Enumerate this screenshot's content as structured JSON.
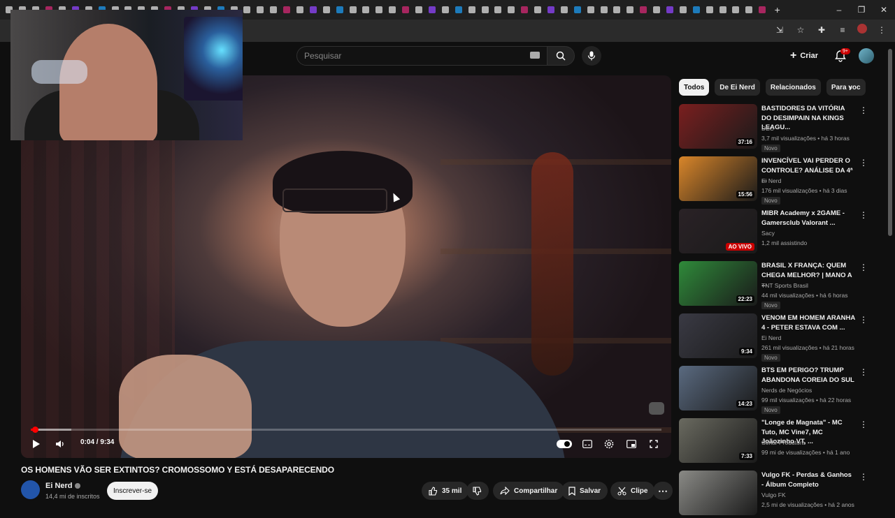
{
  "browser": {
    "tabs": [
      {
        "icon": "tiktok-icon",
        "color": "#e0e0e0"
      },
      {
        "icon": "x-icon",
        "color": "#e0e0e0"
      },
      {
        "icon": "tiktok-icon",
        "color": "#e0e0e0"
      },
      {
        "icon": "instagram-icon",
        "color": "#d62976"
      },
      {
        "icon": "tiktok-icon",
        "color": "#e0e0e0"
      },
      {
        "icon": "twitch-icon",
        "color": "#9146ff"
      },
      {
        "icon": "tiktok-icon",
        "color": "#e0e0e0"
      },
      {
        "icon": "bluesky-icon",
        "color": "#1d9bf0"
      },
      {
        "icon": "x-icon",
        "color": "#e0e0e0"
      }
    ],
    "new_tab": "+",
    "window_controls": [
      "–",
      "❐",
      "✕"
    ]
  },
  "header": {
    "search_placeholder": "Pesquisar",
    "create_label": "Criar",
    "notification_count": "9+"
  },
  "player": {
    "time": "0:04 / 9:34",
    "progress_fraction": 0.007,
    "buffer_fraction": 0.064
  },
  "video": {
    "title": "OS HOMENS VÃO SER EXTINTOS? CROMOSSOMO Y ESTÁ DESAPARECENDO",
    "channel": "Ei Nerd",
    "subscribers": "14,4 mi de inscritos",
    "subscribe_label": "Inscrever-se",
    "likes": "35 mil",
    "share_label": "Compartilhar",
    "save_label": "Salvar",
    "clip_label": "Clipe"
  },
  "chips": [
    "Todos",
    "De Ei Nerd",
    "Relacionados",
    "Para voc"
  ],
  "recommendations": [
    {
      "title": "BASTIDORES DA VITÓRIA DO DESIMPAIN NA KINGS LEAGU...",
      "channel": "DEC",
      "meta": "3,7 mil visualizações • há 3 horas",
      "badge": "Novo",
      "duration": "37:16",
      "thumb": "#7a1f1f"
    },
    {
      "title": "INVENCÍVEL VAI PERDER O CONTROLE? ANÁLISE DA 4ª ...",
      "channel": "Ei Nerd",
      "meta": "176 mil visualizações • há 3 dias",
      "badge": "Novo",
      "duration": "15:56",
      "thumb": "#d9862a"
    },
    {
      "title": "MIBR Academy x 2GAME - Gamersclub Valorant ...",
      "channel": "Sacy",
      "meta": "1,2 mil assistindo",
      "badge": "",
      "duration": "AO VIVO",
      "thumb": "#2a2226"
    },
    {
      "title": "BRASIL X FRANÇA: QUEM CHEGA MELHOR? | MANO A ...",
      "channel": "TNT Sports Brasil",
      "meta": "44 mil visualizações • há 6 horas",
      "badge": "Novo",
      "duration": "22:23",
      "thumb": "#2f8a3a"
    },
    {
      "title": "VENOM EM HOMEM ARANHA 4 - PETER ESTAVA COM ...",
      "channel": "Ei Nerd",
      "meta": "261 mil visualizações • há 21 horas",
      "badge": "Novo",
      "duration": "9:34",
      "thumb": "#3a3a44"
    },
    {
      "title": "BTS EM PERIGO? TRUMP ABANDONA COREIA DO SUL",
      "channel": "Nerds de Negócios",
      "meta": "99 mil visualizações • há 22 horas",
      "badge": "Novo",
      "duration": "14:23",
      "thumb": "#5a6a80"
    },
    {
      "title": "\"Longe de Magnata\" - MC Tuto, MC Vine7, MC Joãozinho VT, ...",
      "channel": "Sonar Produtora",
      "meta": "99 mi de visualizações • há 1 ano",
      "badge": "",
      "duration": "7:33",
      "thumb": "#6a6a60"
    },
    {
      "title": "Vulgo FK - Perdas & Ganhos - Álbum Completo",
      "channel": "Vulgo FK",
      "meta": "2,5 mi de visualizações • há 2 anos",
      "badge": "",
      "duration": "",
      "thumb": "#8a8a86"
    }
  ]
}
